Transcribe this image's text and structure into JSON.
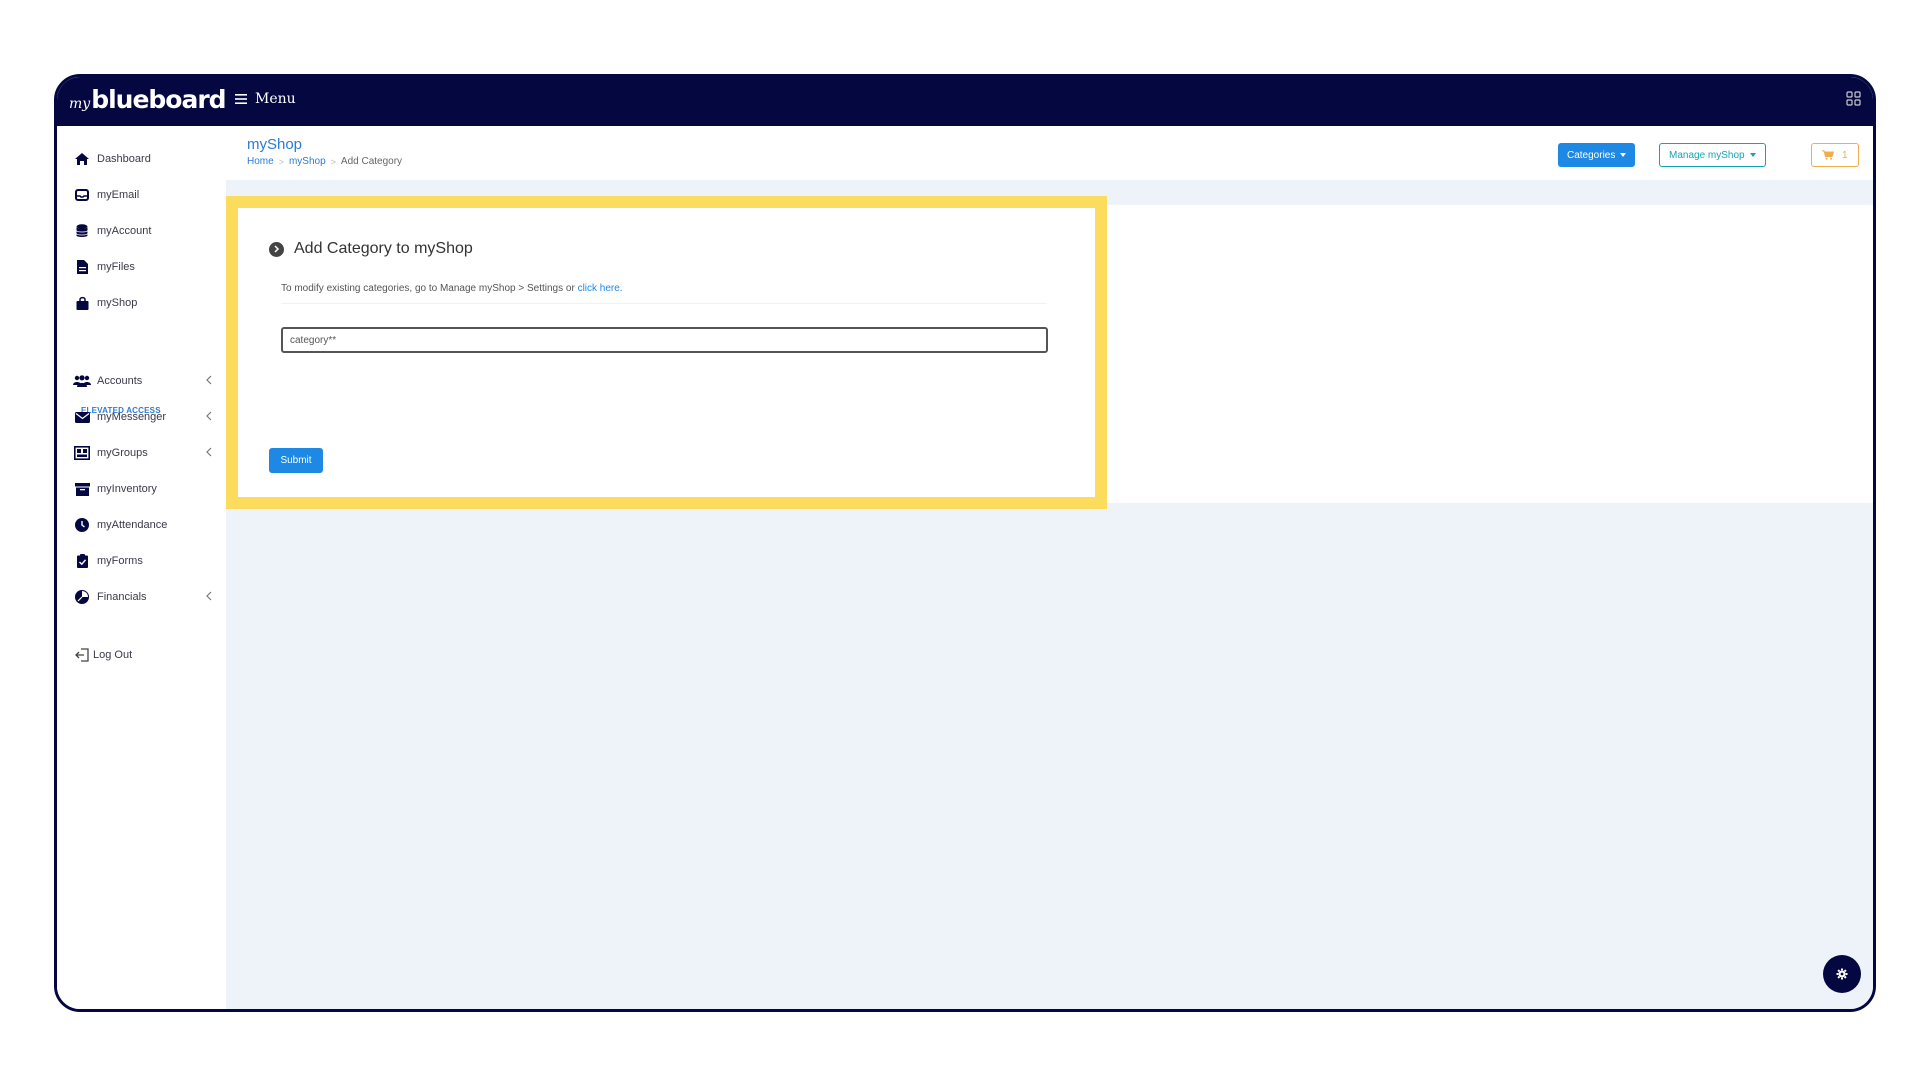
{
  "app": {
    "logo_prefix": "my",
    "logo_main": "blueboard",
    "menu_label": "Menu"
  },
  "sidebar": {
    "items": [
      {
        "label": "Dashboard",
        "icon": "home-icon"
      },
      {
        "label": "myEmail",
        "icon": "inbox-icon"
      },
      {
        "label": "myAccount",
        "icon": "database-icon"
      },
      {
        "label": "myFiles",
        "icon": "file-icon"
      },
      {
        "label": "myShop",
        "icon": "shopping-bag-icon"
      }
    ],
    "section_label": "ELEVATED ACCESS",
    "elevated_items": [
      {
        "label": "Accounts",
        "icon": "users-icon",
        "has_submenu": true
      },
      {
        "label": "myMessenger",
        "icon": "envelope-icon",
        "has_submenu": true
      },
      {
        "label": "myGroups",
        "icon": "group-icon",
        "has_submenu": true
      },
      {
        "label": "myInventory",
        "icon": "archive-icon",
        "has_submenu": false
      },
      {
        "label": "myAttendance",
        "icon": "clock-icon",
        "has_submenu": false
      },
      {
        "label": "myForms",
        "icon": "clipboard-check-icon",
        "has_submenu": false
      },
      {
        "label": "Financials",
        "icon": "chart-icon",
        "has_submenu": true
      }
    ],
    "logout_label": "Log Out"
  },
  "header": {
    "title": "myShop",
    "breadcrumb": [
      {
        "label": "Home"
      },
      {
        "label": "myShop"
      },
      {
        "label": "Add Category"
      }
    ],
    "categories_button": "Categories",
    "manage_button": "Manage myShop",
    "cart_count": "1"
  },
  "card": {
    "title": "Add Category to myShop",
    "description": "To modify existing categories, go to Manage myShop > Settings or ",
    "link_text": "click here.",
    "input_placeholder": "category**",
    "input_value": "",
    "submit_label": "Submit"
  },
  "colors": {
    "navy": "#050741",
    "primary": "#1e88e5",
    "info": "#17a2b8",
    "warning": "#f0ad4e",
    "highlight": "#fcdc5c",
    "background": "#edf3f8"
  }
}
